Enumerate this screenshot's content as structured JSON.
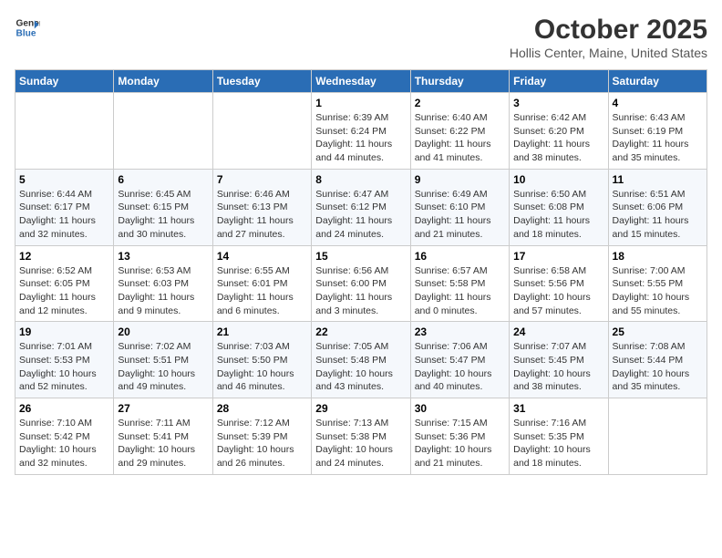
{
  "header": {
    "logo_line1": "General",
    "logo_line2": "Blue",
    "month": "October 2025",
    "location": "Hollis Center, Maine, United States"
  },
  "days_of_week": [
    "Sunday",
    "Monday",
    "Tuesday",
    "Wednesday",
    "Thursday",
    "Friday",
    "Saturday"
  ],
  "weeks": [
    [
      {
        "day": "",
        "info": ""
      },
      {
        "day": "",
        "info": ""
      },
      {
        "day": "",
        "info": ""
      },
      {
        "day": "1",
        "info": "Sunrise: 6:39 AM\nSunset: 6:24 PM\nDaylight: 11 hours\nand 44 minutes."
      },
      {
        "day": "2",
        "info": "Sunrise: 6:40 AM\nSunset: 6:22 PM\nDaylight: 11 hours\nand 41 minutes."
      },
      {
        "day": "3",
        "info": "Sunrise: 6:42 AM\nSunset: 6:20 PM\nDaylight: 11 hours\nand 38 minutes."
      },
      {
        "day": "4",
        "info": "Sunrise: 6:43 AM\nSunset: 6:19 PM\nDaylight: 11 hours\nand 35 minutes."
      }
    ],
    [
      {
        "day": "5",
        "info": "Sunrise: 6:44 AM\nSunset: 6:17 PM\nDaylight: 11 hours\nand 32 minutes."
      },
      {
        "day": "6",
        "info": "Sunrise: 6:45 AM\nSunset: 6:15 PM\nDaylight: 11 hours\nand 30 minutes."
      },
      {
        "day": "7",
        "info": "Sunrise: 6:46 AM\nSunset: 6:13 PM\nDaylight: 11 hours\nand 27 minutes."
      },
      {
        "day": "8",
        "info": "Sunrise: 6:47 AM\nSunset: 6:12 PM\nDaylight: 11 hours\nand 24 minutes."
      },
      {
        "day": "9",
        "info": "Sunrise: 6:49 AM\nSunset: 6:10 PM\nDaylight: 11 hours\nand 21 minutes."
      },
      {
        "day": "10",
        "info": "Sunrise: 6:50 AM\nSunset: 6:08 PM\nDaylight: 11 hours\nand 18 minutes."
      },
      {
        "day": "11",
        "info": "Sunrise: 6:51 AM\nSunset: 6:06 PM\nDaylight: 11 hours\nand 15 minutes."
      }
    ],
    [
      {
        "day": "12",
        "info": "Sunrise: 6:52 AM\nSunset: 6:05 PM\nDaylight: 11 hours\nand 12 minutes."
      },
      {
        "day": "13",
        "info": "Sunrise: 6:53 AM\nSunset: 6:03 PM\nDaylight: 11 hours\nand 9 minutes."
      },
      {
        "day": "14",
        "info": "Sunrise: 6:55 AM\nSunset: 6:01 PM\nDaylight: 11 hours\nand 6 minutes."
      },
      {
        "day": "15",
        "info": "Sunrise: 6:56 AM\nSunset: 6:00 PM\nDaylight: 11 hours\nand 3 minutes."
      },
      {
        "day": "16",
        "info": "Sunrise: 6:57 AM\nSunset: 5:58 PM\nDaylight: 11 hours\nand 0 minutes."
      },
      {
        "day": "17",
        "info": "Sunrise: 6:58 AM\nSunset: 5:56 PM\nDaylight: 10 hours\nand 57 minutes."
      },
      {
        "day": "18",
        "info": "Sunrise: 7:00 AM\nSunset: 5:55 PM\nDaylight: 10 hours\nand 55 minutes."
      }
    ],
    [
      {
        "day": "19",
        "info": "Sunrise: 7:01 AM\nSunset: 5:53 PM\nDaylight: 10 hours\nand 52 minutes."
      },
      {
        "day": "20",
        "info": "Sunrise: 7:02 AM\nSunset: 5:51 PM\nDaylight: 10 hours\nand 49 minutes."
      },
      {
        "day": "21",
        "info": "Sunrise: 7:03 AM\nSunset: 5:50 PM\nDaylight: 10 hours\nand 46 minutes."
      },
      {
        "day": "22",
        "info": "Sunrise: 7:05 AM\nSunset: 5:48 PM\nDaylight: 10 hours\nand 43 minutes."
      },
      {
        "day": "23",
        "info": "Sunrise: 7:06 AM\nSunset: 5:47 PM\nDaylight: 10 hours\nand 40 minutes."
      },
      {
        "day": "24",
        "info": "Sunrise: 7:07 AM\nSunset: 5:45 PM\nDaylight: 10 hours\nand 38 minutes."
      },
      {
        "day": "25",
        "info": "Sunrise: 7:08 AM\nSunset: 5:44 PM\nDaylight: 10 hours\nand 35 minutes."
      }
    ],
    [
      {
        "day": "26",
        "info": "Sunrise: 7:10 AM\nSunset: 5:42 PM\nDaylight: 10 hours\nand 32 minutes."
      },
      {
        "day": "27",
        "info": "Sunrise: 7:11 AM\nSunset: 5:41 PM\nDaylight: 10 hours\nand 29 minutes."
      },
      {
        "day": "28",
        "info": "Sunrise: 7:12 AM\nSunset: 5:39 PM\nDaylight: 10 hours\nand 26 minutes."
      },
      {
        "day": "29",
        "info": "Sunrise: 7:13 AM\nSunset: 5:38 PM\nDaylight: 10 hours\nand 24 minutes."
      },
      {
        "day": "30",
        "info": "Sunrise: 7:15 AM\nSunset: 5:36 PM\nDaylight: 10 hours\nand 21 minutes."
      },
      {
        "day": "31",
        "info": "Sunrise: 7:16 AM\nSunset: 5:35 PM\nDaylight: 10 hours\nand 18 minutes."
      },
      {
        "day": "",
        "info": ""
      }
    ]
  ]
}
